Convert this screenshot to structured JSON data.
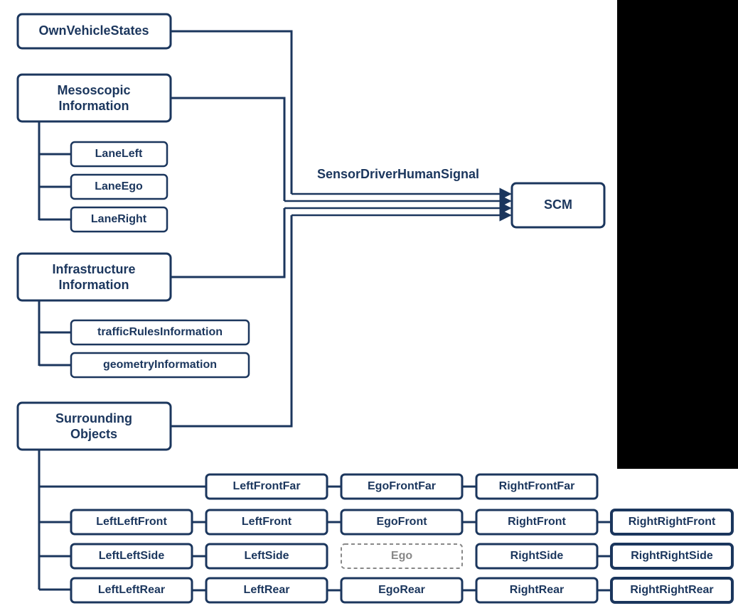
{
  "diagram": {
    "title_signal": "SensorDriverHumanSignal",
    "target": "SCM",
    "ownVehicle": "OwnVehicleStates",
    "mesoscopic": {
      "label_line1": "Mesoscopic",
      "label_line2": "Information",
      "children": [
        "LaneLeft",
        "LaneEgo",
        "LaneRight"
      ]
    },
    "infrastructure": {
      "label_line1": "Infrastructure",
      "label_line2": "Information",
      "children": [
        "trafficRulesInformation",
        "geometryInformation"
      ]
    },
    "surrounding": {
      "label_line1": "Surrounding",
      "label_line2": "Objects",
      "grid": {
        "row0": [
          "",
          "LeftFrontFar",
          "EgoFrontFar",
          "RightFrontFar",
          ""
        ],
        "row1": [
          "LeftLeftFront",
          "LeftFront",
          "EgoFront",
          "RightFront",
          "RightRightFront"
        ],
        "row2": [
          "LeftLeftSide",
          "LeftSide",
          "Ego",
          "RightSide",
          "RightRightSide"
        ],
        "row3": [
          "LeftLeftRear",
          "LeftRear",
          "EgoRear",
          "RightRear",
          "RightRightRear"
        ]
      }
    }
  }
}
